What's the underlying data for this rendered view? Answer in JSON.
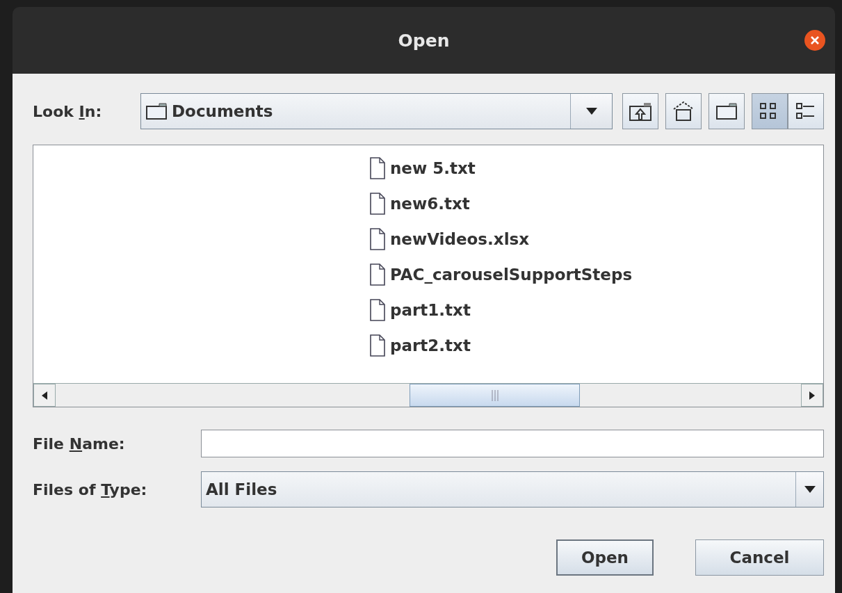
{
  "window": {
    "title": "Open"
  },
  "look_in": {
    "label_parts": [
      "Look ",
      "I",
      "n:"
    ],
    "value": "Documents"
  },
  "toolbar": [
    {
      "kind": "up",
      "selected": false
    },
    {
      "kind": "home",
      "selected": false
    },
    {
      "kind": "new-folder",
      "selected": false
    },
    {
      "kind": "list",
      "selected": true
    },
    {
      "kind": "details",
      "selected": false
    }
  ],
  "files": [
    {
      "name": "new 5.txt",
      "selected": false
    },
    {
      "name": "new6.txt",
      "selected": false
    },
    {
      "name": "newVideos.xlsx",
      "selected": false
    },
    {
      "name": "PAC_carouselSupportSteps",
      "selected": false
    },
    {
      "name": "part1.txt",
      "selected": false
    },
    {
      "name": "part2.txt",
      "selected": false
    }
  ],
  "file_name": {
    "label_parts": [
      "File ",
      "N",
      "ame:"
    ]
  },
  "files_of_type": {
    "label_parts": [
      "Files of ",
      "T",
      "ype:"
    ],
    "value": "All Files"
  },
  "buttons": [
    {
      "label": "Open",
      "default": true
    },
    {
      "label": "Cancel",
      "default": false
    }
  ]
}
